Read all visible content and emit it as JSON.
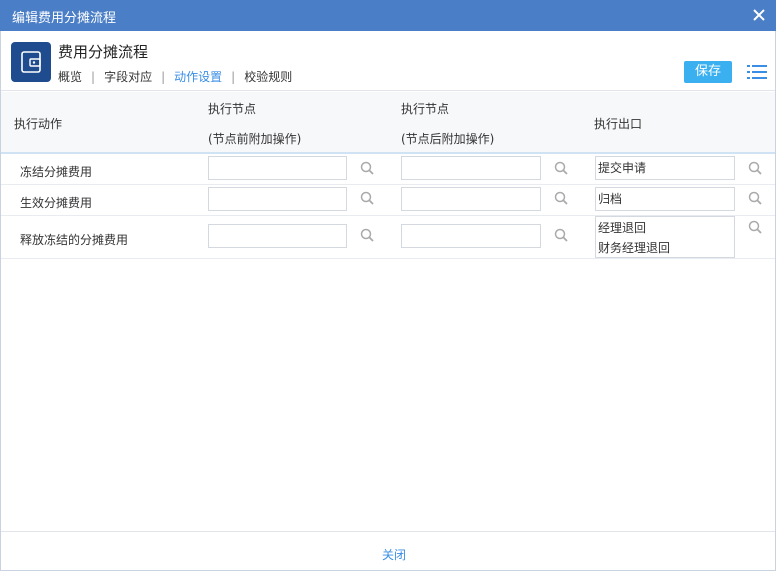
{
  "window": {
    "title": "编辑费用分摊流程"
  },
  "header": {
    "app_title": "费用分摊流程",
    "tabs": [
      {
        "label": "概览"
      },
      {
        "label": "字段对应"
      },
      {
        "label": "动作设置"
      },
      {
        "label": "校验规则"
      }
    ],
    "active_tab": "动作设置",
    "save_label": "保存"
  },
  "table": {
    "col_action": "执行动作",
    "col_before_line1": "执行节点",
    "col_before_line2": "(节点前附加操作)",
    "col_after_line1": "执行节点",
    "col_after_line2": "(节点后附加操作)",
    "col_exit": "执行出口",
    "rows": [
      {
        "action": "冻结分摊费用",
        "before": "",
        "after": "",
        "exit_line1": "提交申请",
        "exit_line2": ""
      },
      {
        "action": "生效分摊费用",
        "before": "",
        "after": "",
        "exit_line1": "归档",
        "exit_line2": ""
      },
      {
        "action": "释放冻结的分摊费用",
        "before": "",
        "after": "",
        "exit_line1": "经理退回",
        "exit_line2": "财务经理退回"
      }
    ]
  },
  "footer": {
    "close_label": "关闭"
  },
  "colors": {
    "titlebar": "#4a7ec6",
    "accent": "#3a8ee6",
    "save_button": "#3ab0f0",
    "app_icon": "#1e4c8e"
  }
}
